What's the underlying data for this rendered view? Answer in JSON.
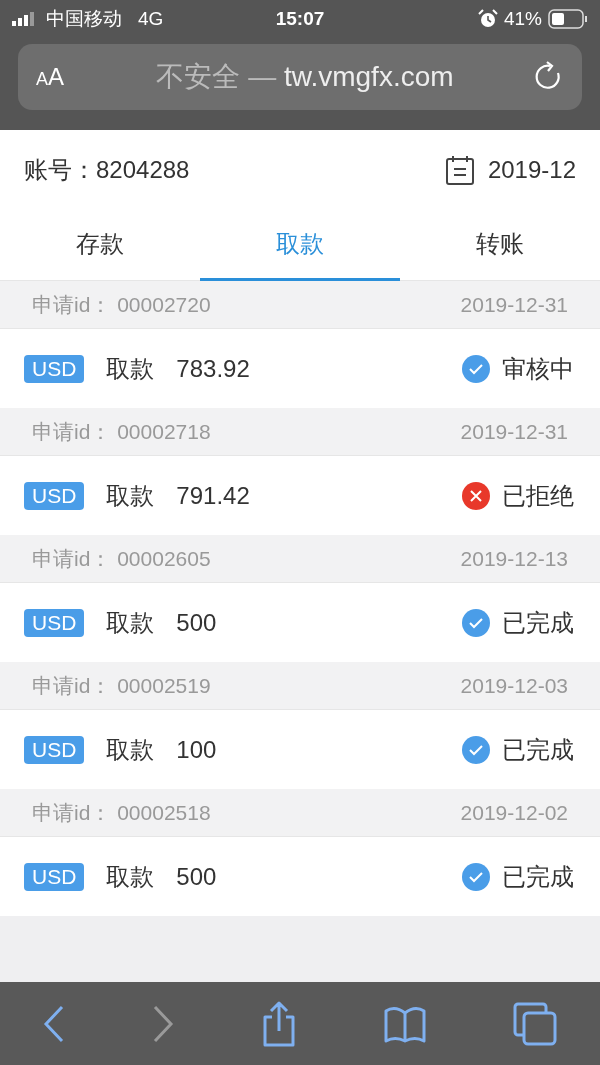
{
  "status_bar": {
    "carrier": "中国移动",
    "network": "4G",
    "time": "15:07",
    "battery": "41%"
  },
  "address_bar": {
    "text_size": "AA",
    "security": "不安全 —",
    "url": "tw.vmgfx.com"
  },
  "header": {
    "account_label": "账号：",
    "account": "8204288",
    "month": "2019-12"
  },
  "tabs": [
    {
      "label": "存款",
      "selected": false
    },
    {
      "label": "取款",
      "selected": true
    },
    {
      "label": "转账",
      "selected": false
    }
  ],
  "records": [
    {
      "id_label": "申请id：",
      "id": "00002720",
      "date": "2019-12-31",
      "currency": "USD",
      "type": "取款",
      "amount": "783.92",
      "status": "审核中",
      "kind": "check"
    },
    {
      "id_label": "申请id：",
      "id": "00002718",
      "date": "2019-12-31",
      "currency": "USD",
      "type": "取款",
      "amount": "791.42",
      "status": "已拒绝",
      "kind": "cross"
    },
    {
      "id_label": "申请id：",
      "id": "00002605",
      "date": "2019-12-13",
      "currency": "USD",
      "type": "取款",
      "amount": "500",
      "status": "已完成",
      "kind": "check"
    },
    {
      "id_label": "申请id：",
      "id": "00002519",
      "date": "2019-12-03",
      "currency": "USD",
      "type": "取款",
      "amount": "100",
      "status": "已完成",
      "kind": "check"
    },
    {
      "id_label": "申请id：",
      "id": "00002518",
      "date": "2019-12-02",
      "currency": "USD",
      "type": "取款",
      "amount": "500",
      "status": "已完成",
      "kind": "check"
    }
  ],
  "toolbar": {
    "back_disabled": false,
    "forward_disabled": true
  }
}
